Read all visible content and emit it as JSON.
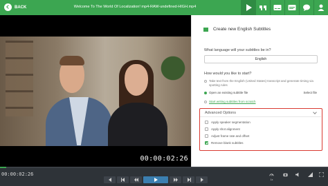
{
  "header": {
    "back_label": "BACK",
    "title": "Welcome To The World Of Localization! mp4-RAW-undefined-HIGH.mp4",
    "icons": [
      "play-icon",
      "quote-icon",
      "subtitles-icon",
      "subtitles-alt-icon",
      "chat-icon",
      "user-icon"
    ],
    "active_icon": "play-icon",
    "brand_color": "#3ca651"
  },
  "video": {
    "timecode": "00:00:02:26"
  },
  "panel": {
    "title": "Create new English Subtitles",
    "language_question": "What language will your subtitles be in?",
    "language_value": "English",
    "start_question": "How would you like to start?",
    "options": [
      "Take text from the English (United States) transcript and generate timing via spotting rules",
      "Open an existing subtitle file",
      "Start writing subtitles from scratch"
    ],
    "selected_option": 1,
    "select_file_label": "Select file",
    "advanced": {
      "title": "Advanced Options",
      "items": [
        {
          "label": "Apply speaker segmentation",
          "checked": false
        },
        {
          "label": "Apply shot alignment",
          "checked": false
        },
        {
          "label": "Adjust frame rate and offset",
          "checked": false
        },
        {
          "label": "Remove blank subtitles",
          "checked": true
        }
      ]
    }
  },
  "footer": {
    "time": "00:00:02:26",
    "progress_percent": 2,
    "controls": [
      "skip-back-icon",
      "step-back-icon",
      "rewind-icon",
      "play-icon",
      "fast-forward-icon",
      "step-forward-icon",
      "skip-forward-icon"
    ],
    "speed_label": "1x"
  }
}
